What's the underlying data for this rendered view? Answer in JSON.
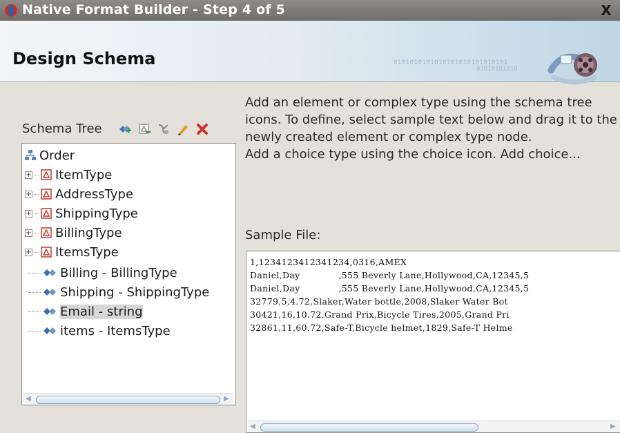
{
  "window": {
    "title": "Native Format Builder - Step 4 of 5",
    "close_label": "X"
  },
  "header": {
    "title": "Design Schema",
    "decoration_text_1": "0101010101010101010101010101",
    "decoration_text_2": "01010101010"
  },
  "schema_tree": {
    "label": "Schema Tree",
    "toolbar_icons": [
      "add-element-icon",
      "add-complex-type-icon",
      "add-choice-icon",
      "edit-icon",
      "delete-icon"
    ],
    "root": "Order",
    "items": [
      {
        "label": "ItemType",
        "kind": "complex-type",
        "expandable": true
      },
      {
        "label": "AddressType",
        "kind": "complex-type",
        "expandable": true
      },
      {
        "label": "ShippingType",
        "kind": "complex-type",
        "expandable": true
      },
      {
        "label": "BillingType",
        "kind": "complex-type",
        "expandable": true
      },
      {
        "label": "ItemsType",
        "kind": "complex-type",
        "expandable": true
      },
      {
        "label": "Billing - BillingType",
        "kind": "element",
        "expandable": false
      },
      {
        "label": "Shipping - ShippingType",
        "kind": "element",
        "expandable": false
      },
      {
        "label": "Email - string",
        "kind": "element",
        "expandable": false,
        "selected": true
      },
      {
        "label": "items - ItemsType",
        "kind": "element",
        "expandable": false
      }
    ]
  },
  "instructions": {
    "line1": "Add an element or complex type using the schema tree icons. To define, select sample text below and drag it to the newly created element or complex type node.",
    "line2": "Add a choice type using the choice icon. Add choice..."
  },
  "sample": {
    "label": "Sample File:",
    "lines": [
      "1,1234123412341234,0316,AMEX",
      "Daniel,Day",
      ",555 Beverly Lane,Hollywood,CA,12345,5",
      "Daniel,Day",
      ",555 Beverly Lane,Hollywood,CA,12345,5",
      "32779,5,4.72,Slaker,Water bottle,2008,Slaker Water Bot",
      "30421,16,10.72,Grand Prix,Bicycle Tires,2005,Grand Pri",
      "32861,11,60.72,Safe-T,Bicycle helmet,1829,Safe-T Helme"
    ]
  },
  "colors": {
    "title_bar": "#7e7d7a",
    "header_accent": "#bfd6e6",
    "selection": "#d7d7d7",
    "delete_icon": "#d0312d",
    "type_icon": "#c0392b"
  }
}
